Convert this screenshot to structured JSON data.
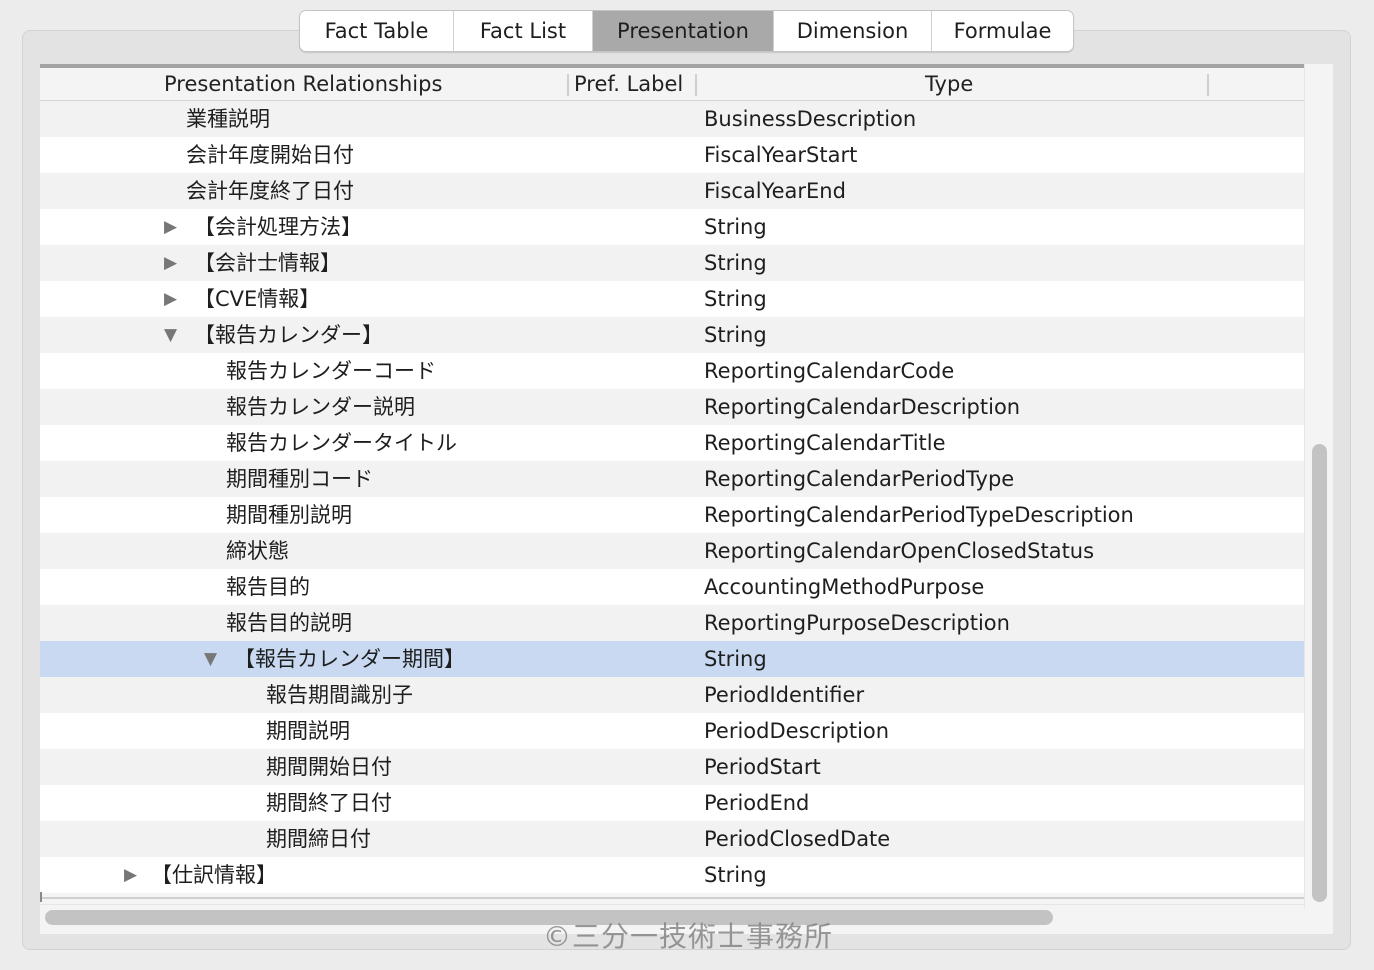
{
  "tabs": [
    {
      "label": "Fact Table"
    },
    {
      "label": "Fact List"
    },
    {
      "label": "Presentation"
    },
    {
      "label": "Dimension"
    },
    {
      "label": "Formulae"
    }
  ],
  "columns": {
    "relationships": "Presentation Relationships",
    "pref_label": "Pref. Label",
    "type": "Type"
  },
  "rows": [
    {
      "label": "業種説明",
      "type": "BusinessDescription"
    },
    {
      "label": "会計年度開始日付",
      "type": "FiscalYearStart"
    },
    {
      "label": "会計年度終了日付",
      "type": "FiscalYearEnd"
    },
    {
      "label": "【会計処理方法】",
      "type": "String",
      "toggle": "collapsed"
    },
    {
      "label": "【会計士情報】",
      "type": "String",
      "toggle": "collapsed"
    },
    {
      "label": "【CVE情報】",
      "type": "String",
      "toggle": "collapsed"
    },
    {
      "label": "【報告カレンダー】",
      "type": "String",
      "toggle": "expanded"
    },
    {
      "label": "報告カレンダーコード",
      "type": "ReportingCalendarCode"
    },
    {
      "label": "報告カレンダー説明",
      "type": "ReportingCalendarDescription"
    },
    {
      "label": "報告カレンダータイトル",
      "type": "ReportingCalendarTitle"
    },
    {
      "label": "期間種別コード",
      "type": "ReportingCalendarPeriodType"
    },
    {
      "label": "期間種別説明",
      "type": "ReportingCalendarPeriodTypeDescription"
    },
    {
      "label": "締状態",
      "type": "ReportingCalendarOpenClosedStatus"
    },
    {
      "label": "報告目的",
      "type": "AccountingMethodPurpose"
    },
    {
      "label": "報告目的説明",
      "type": "ReportingPurposeDescription"
    },
    {
      "label": "【報告カレンダー期間】",
      "type": "String",
      "toggle": "expanded",
      "selected": true
    },
    {
      "label": "報告期間識別子",
      "type": "PeriodIdentifier"
    },
    {
      "label": "期間説明",
      "type": "PeriodDescription"
    },
    {
      "label": "期間開始日付",
      "type": "PeriodStart"
    },
    {
      "label": "期間終了日付",
      "type": "PeriodEnd"
    },
    {
      "label": "期間締日付",
      "type": "PeriodClosedDate"
    },
    {
      "label": "【仕訳情報】",
      "type": "String",
      "toggle": "collapsed"
    }
  ],
  "watermark": "©三分一技術士事務所",
  "icons": {
    "collapsed": "disclosure-triangle-right-icon",
    "expanded": "disclosure-triangle-down-icon"
  },
  "colors": {
    "selected_row": "#c8d9f1",
    "active_tab": "#a9a9a9"
  }
}
